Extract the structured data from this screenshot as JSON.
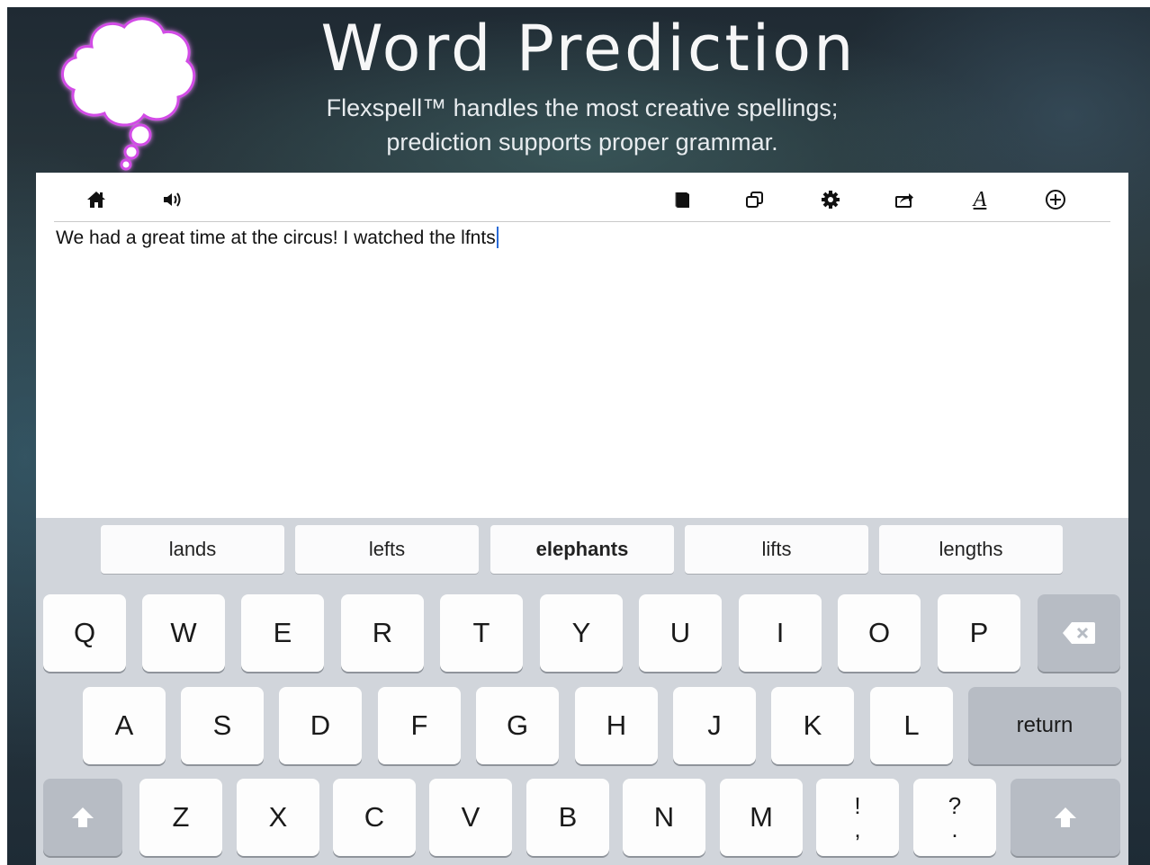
{
  "header": {
    "title": "Word Prediction",
    "subtitle_line1": "Flexspell™ handles the most creative spellings;",
    "subtitle_line2": "prediction supports proper grammar."
  },
  "toolbar": {
    "left_icons": [
      "home-icon",
      "speaker-icon"
    ],
    "right_icons": [
      "book-icon",
      "copy-icon",
      "gear-icon",
      "share-icon",
      "font-icon",
      "add-icon"
    ],
    "font_glyph": "A"
  },
  "document": {
    "text": "We had a great time at the circus! I watched the lfnts"
  },
  "predictions": [
    "lands",
    "lefts",
    "elephants",
    "lifts",
    "lengths"
  ],
  "keyboard": {
    "row1": [
      "Q",
      "W",
      "E",
      "R",
      "T",
      "Y",
      "U",
      "I",
      "O",
      "P"
    ],
    "row2": [
      "A",
      "S",
      "D",
      "F",
      "G",
      "H",
      "J",
      "K",
      "L"
    ],
    "row3": [
      "Z",
      "X",
      "C",
      "V",
      "B",
      "N",
      "M"
    ],
    "exclaim_top": "!",
    "exclaim_bottom": ",",
    "question_top": "?",
    "question_bottom": ".",
    "return_label": "return",
    "backspace_icon": "backspace-icon",
    "shift_icon": "shift-icon"
  },
  "colors": {
    "caret": "#2a6bd8",
    "cloud_glow": "#c04ad8",
    "keyboard_bg": "#d1d5db"
  }
}
